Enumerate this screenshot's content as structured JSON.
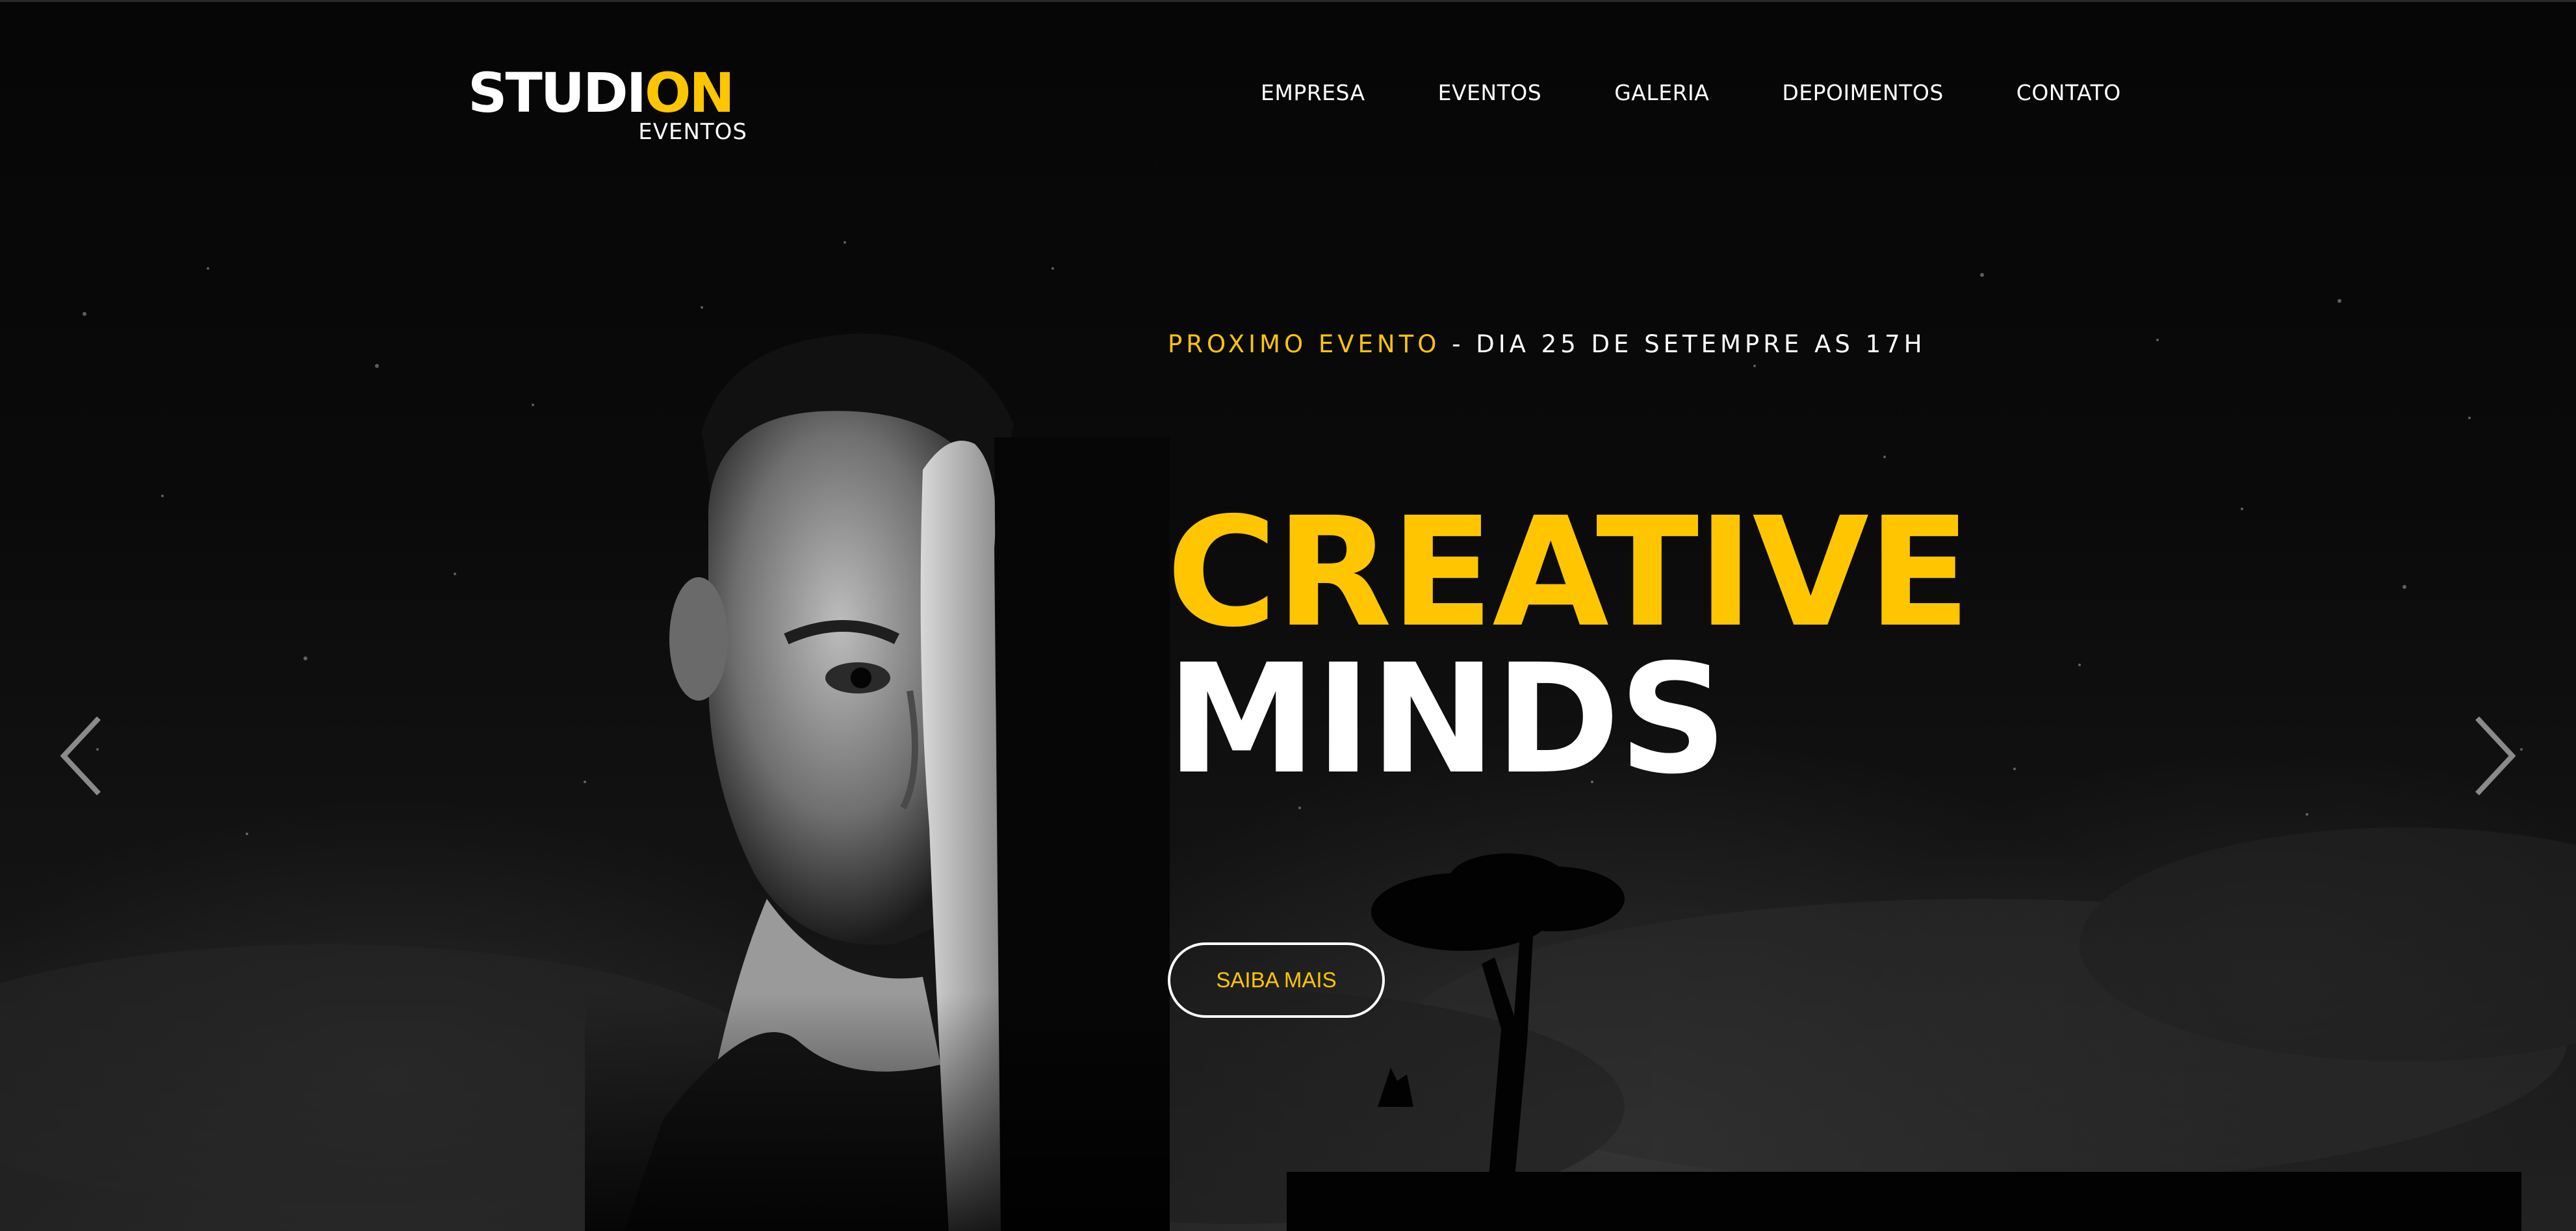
{
  "brand": {
    "name_part1": "STUDI",
    "name_part2": "ON",
    "subtitle": "EVENTOS",
    "accent_color": "#ffc600"
  },
  "nav": {
    "items": [
      {
        "label": "EMPRESA"
      },
      {
        "label": "EVENTOS"
      },
      {
        "label": "GALERIA"
      },
      {
        "label": "DEPOIMENTOS"
      },
      {
        "label": "CONTATO"
      }
    ]
  },
  "hero": {
    "event_label": "PROXIMO EVENTO",
    "event_separator": "-",
    "event_date": "DIA 25 DE SETEMPRE AS 17H",
    "headline_line1": "CREATIVE",
    "headline_line2": "MINDS",
    "cta_label": "SAIBA MAIS"
  },
  "slider": {
    "prev_icon": "chevron-left-icon",
    "next_icon": "chevron-right-icon"
  },
  "colors": {
    "background": "#050505",
    "accent": "#ffc600",
    "text": "#ffffff"
  }
}
